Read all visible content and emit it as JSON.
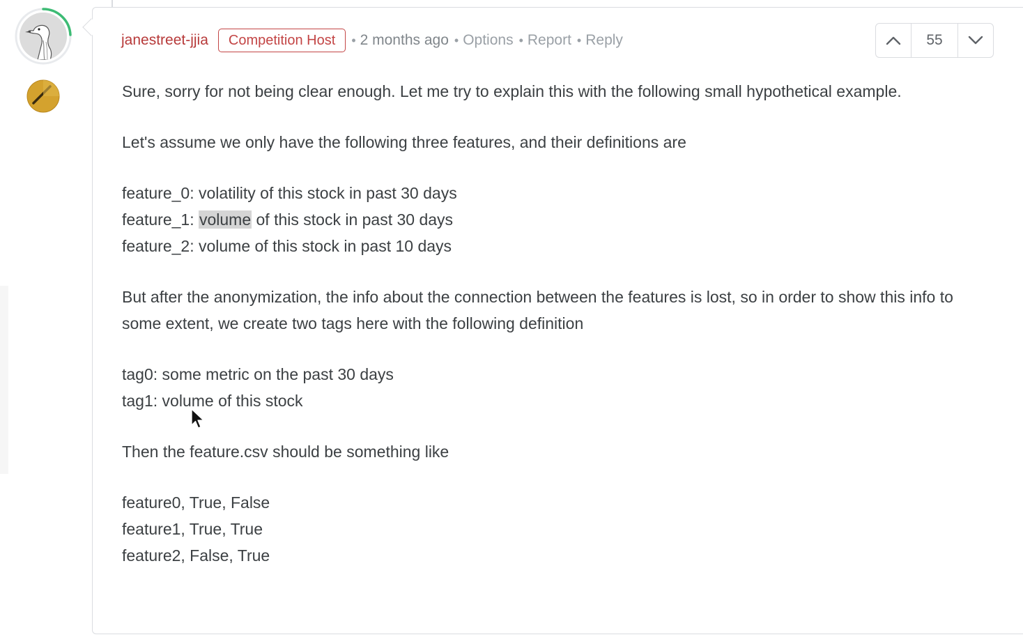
{
  "comment": {
    "author": "janestreet-jjia",
    "badge": "Competition Host",
    "time": "2 months ago",
    "actions": {
      "options": "Options",
      "report": "Report",
      "reply": "Reply"
    },
    "votes": "55",
    "body": {
      "p1": "Sure, sorry for not being clear enough. Let me try to explain this with the following small hypothetical example.",
      "p2": "Let's assume we only have the following three features, and their definitions are",
      "features": {
        "f0": "feature_0: volatility of this stock in past 30 days",
        "f1_prefix": "feature_1: ",
        "f1_highlight": "volume",
        "f1_suffix": " of this stock in past 30 days",
        "f2": "feature_2: volume of this stock in past 10 days"
      },
      "p3": "But after the anonymization, the info about the connection between the features is lost, so in order to show this info to some extent, we create two tags here with the following definition",
      "tags": [
        "tag0: some metric on the past 30 days",
        "tag1: volume of this stock"
      ],
      "p4": "Then the feature.csv should be something like",
      "csv_rows": [
        "feature0, True, False",
        "feature1, True, True",
        "feature2, False, True"
      ]
    }
  },
  "colors": {
    "author": "#b73a3a",
    "badge": "#c34545",
    "text": "#3c4043",
    "meta": "#9aa0a6",
    "progress_ring": "#3dbb74",
    "tier_badge": "#d4a22e"
  },
  "icons": {
    "avatar": "goose-avatar",
    "tier": "expert-tier-icon",
    "upvote": "chevron-up-icon",
    "downvote": "chevron-down-icon",
    "pointer": "mouse-pointer-icon"
  }
}
